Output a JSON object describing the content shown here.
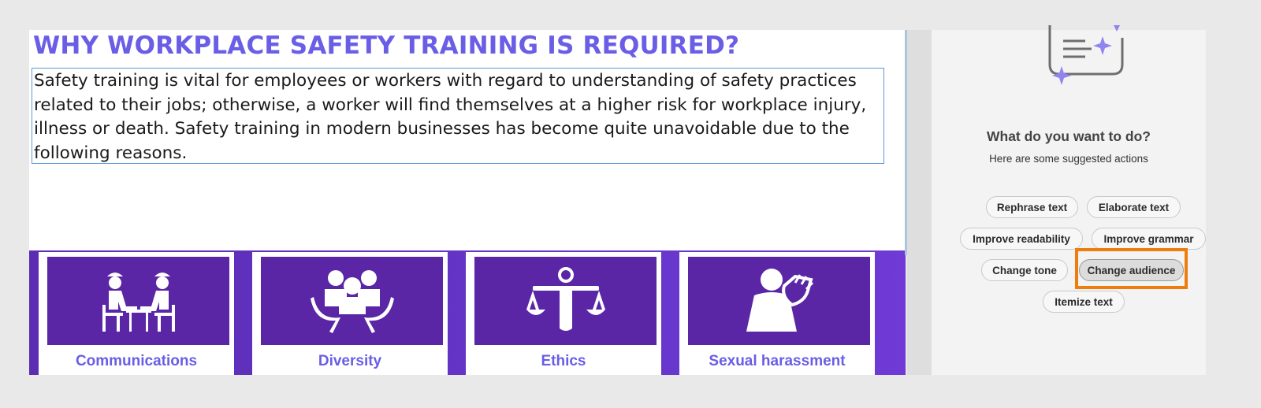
{
  "document": {
    "heading": "WHY WORKPLACE SAFETY TRAINING IS REQUIRED?",
    "paragraph": "Safety training is vital for employees or workers with regard to understanding of safety practices related to their jobs; otherwise, a worker will find themselves at a higher risk for workplace injury, illness or death. Safety training in modern businesses has become quite unavoidable due to the following reasons.",
    "cards": [
      {
        "label": "Communications",
        "icon": "meeting-people-icon"
      },
      {
        "label": "Diversity",
        "icon": "group-hands-icon"
      },
      {
        "label": "Ethics",
        "icon": "scales-icon"
      },
      {
        "label": "Sexual harassment",
        "icon": "harassment-icon"
      }
    ]
  },
  "panel": {
    "illustration": "ai-sparkle-document-icon",
    "title": "What do you want to do?",
    "subtitle": "Here are some suggested actions",
    "actions": [
      {
        "label": "Rephrase text"
      },
      {
        "label": "Elaborate text"
      },
      {
        "label": "Improve readability"
      },
      {
        "label": "Improve grammar"
      },
      {
        "label": "Change tone"
      },
      {
        "label": "Change audience",
        "selected": true
      },
      {
        "label": "Itemize text"
      }
    ]
  },
  "colors": {
    "heading": "#6a5de6",
    "band": "#6535c9",
    "card_image": "#5a26a6",
    "highlight": "#ef7d0d"
  }
}
